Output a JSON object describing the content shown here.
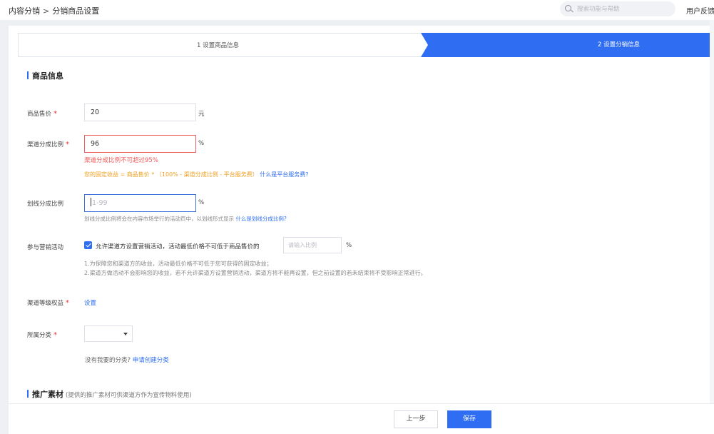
{
  "breadcrumb": {
    "root": "内容分销",
    "separator": ">",
    "current": "分销商品设置"
  },
  "search": {
    "placeholder": "搜索功能与帮助"
  },
  "header": {
    "feedback": "用户反馈"
  },
  "steps": [
    {
      "label": "1 设置商品信息",
      "active": false
    },
    {
      "label": "2 设置分销信息",
      "active": true
    }
  ],
  "colors": {
    "primary": "#2f6ef2",
    "error": "#f05a5a",
    "warning": "#f0a020"
  },
  "section_product": {
    "title": "商品信息"
  },
  "price": {
    "label": "商品售价",
    "required": "*",
    "value": "20",
    "unit": "元"
  },
  "channel_ratio": {
    "label": "渠道分成比例",
    "required": "*",
    "value": "96",
    "unit": "%",
    "error": "渠道分成比例不可超过95%",
    "formula": "您的固定收益 = 商品售价 * （100% - 渠道分成比例 - 平台服务费）",
    "formula_link": "什么是平台服务费?"
  },
  "strike_ratio": {
    "label": "划线分成比例",
    "placeholder": "1-99",
    "unit": "%",
    "hint": "划线分成比例将会在内容市场举行的活动页中，以划线形式显示",
    "hint_link": "什么是划线分成比例?"
  },
  "marketing": {
    "label": "参与营销活动",
    "checkbox_label": "允许渠道方设置营销活动，活动最低价格不可低于商品售价的",
    "checked": true,
    "input_placeholder": "请输入比例",
    "unit": "%",
    "note1": "1.为保障您和渠道方的收益，活动最低价格不可低于您可获得的固定收益；",
    "note2": "2.渠道方做活动不会影响您的收益，若不允许渠道方设置营销活动，渠道方将不能再设置，但之前设置的若未结束将不受影响正常进行。"
  },
  "channel_level": {
    "label": "渠道等级权益",
    "required": "*",
    "link": "设置"
  },
  "category": {
    "label": "所属分类",
    "required": "*",
    "missing_text": "没有我要的分类?",
    "missing_link": "申请创建分类"
  },
  "section_promo": {
    "title": "推广素材",
    "note": "(提供的推广素材可供渠道方作为宣传物料使用)"
  },
  "footer": {
    "prev": "上一步",
    "save": "保存"
  }
}
